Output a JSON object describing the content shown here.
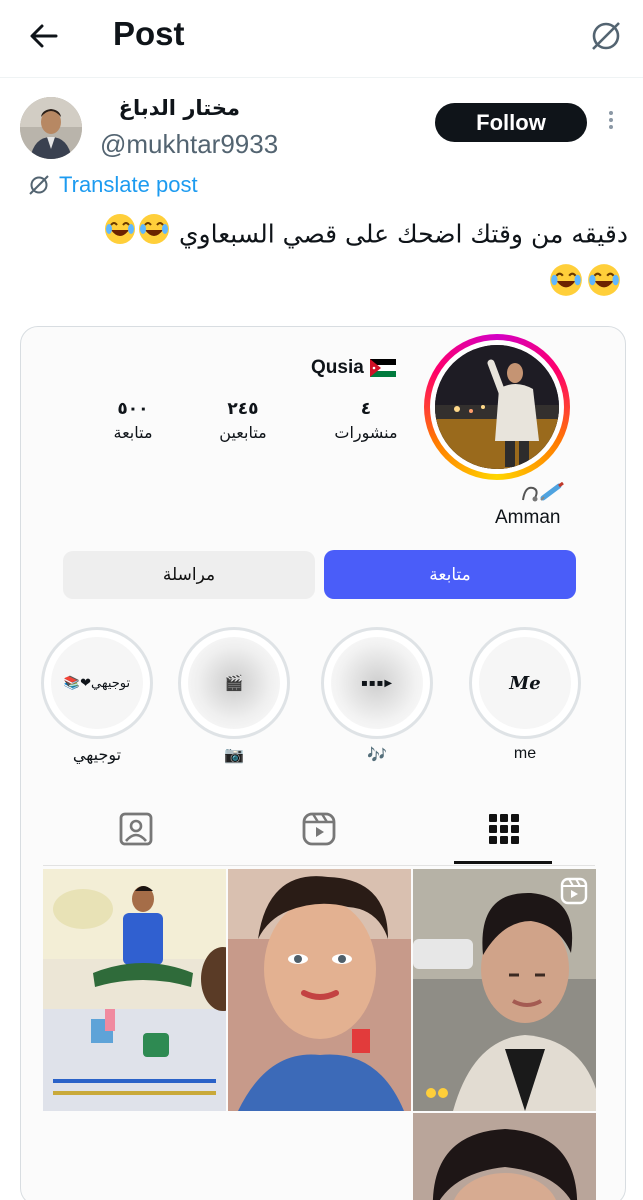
{
  "header": {
    "title": "Post",
    "back_icon": "arrow-left-icon",
    "translate_icon": "globe-slash-icon"
  },
  "author": {
    "name": "مختار الدباغ",
    "handle": "@mukhtar9933",
    "follow_label": "Follow"
  },
  "translate_label": "Translate post",
  "tweet": {
    "text": "دقيقه من وقتك اضحك على قصي السبعاوي",
    "emoji": "😂"
  },
  "embedded_profile": {
    "username": "Qusia",
    "flag": "jordan-flag-icon",
    "stats": [
      {
        "value": "٤",
        "label": "منشورات"
      },
      {
        "value": "٢٤٥",
        "label": "متابعين"
      },
      {
        "value": "٥٠٠",
        "label": "متابعة"
      }
    ],
    "bio_emoji": "💉🩺",
    "bio_city": "Amman",
    "follow_label": "متابعة",
    "message_label": "مراسلة",
    "highlights": [
      {
        "label": "me",
        "cover": "Me"
      },
      {
        "label": "🎶",
        "cover": "▪▪▪▶"
      },
      {
        "label": "📷",
        "cover": "🎬"
      },
      {
        "label": "توجيهي",
        "cover": "توجيهي❤📚"
      }
    ],
    "tabs": [
      "grid-icon",
      "reels-icon",
      "tagged-icon"
    ]
  },
  "colors": {
    "link_blue": "#1d9bf0",
    "insta_blue": "#4a5df9",
    "text": "#0f1419",
    "muted": "#536471"
  }
}
